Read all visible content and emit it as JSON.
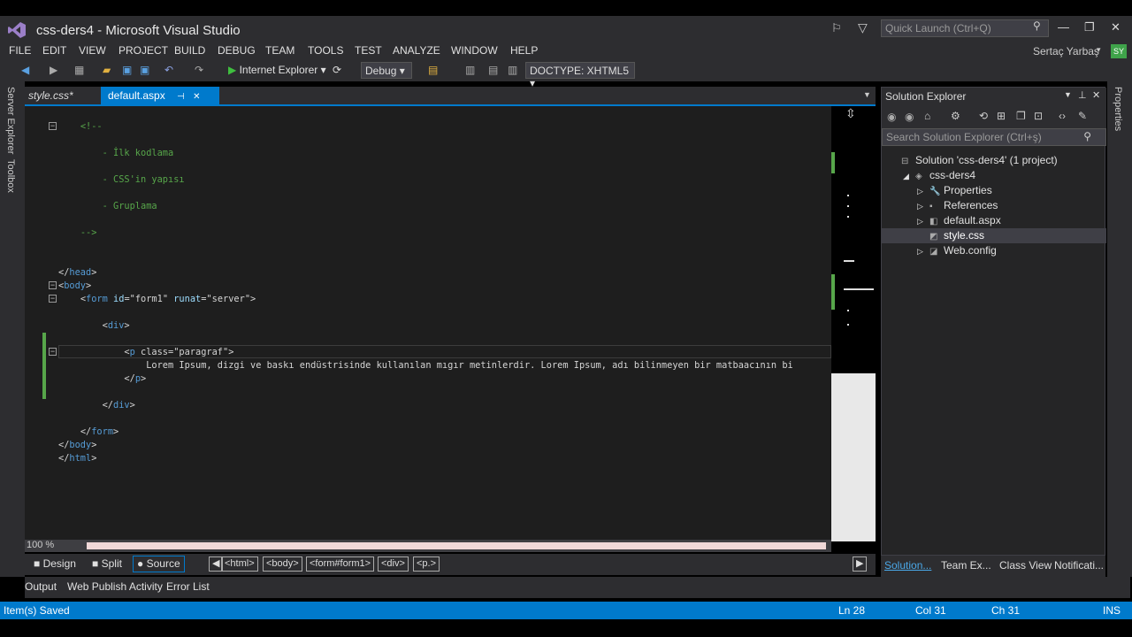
{
  "window": {
    "title": "css-ders4 - Microsoft Visual Studio",
    "quick_launch_placeholder": "Quick Launch (Ctrl+Q)",
    "user_name": "Sertaç Yarbaş",
    "avatar_initials": "SY"
  },
  "menu": [
    "FILE",
    "EDIT",
    "VIEW",
    "PROJECT",
    "BUILD",
    "DEBUG",
    "TEAM",
    "TOOLS",
    "TEST",
    "ANALYZE",
    "WINDOW",
    "HELP"
  ],
  "toolbar": {
    "run_label": "Internet Explorer",
    "config": "Debug",
    "doctype": "DOCTYPE: XHTML5"
  },
  "left_rail": [
    "Server Explorer",
    "Toolbox"
  ],
  "right_rail": [
    "Properties"
  ],
  "tabs": [
    {
      "label": "style.css*",
      "active": false
    },
    {
      "label": "default.aspx",
      "active": true
    }
  ],
  "code": [
    {
      "indent": "    ",
      "parts": [
        {
          "c": "c-comment",
          "t": "<!--"
        }
      ]
    },
    {
      "indent": "        ",
      "parts": [
        {
          "c": "c-comment",
          "t": "- İlk kodlama"
        }
      ]
    },
    {
      "indent": "        ",
      "parts": [
        {
          "c": "c-comment",
          "t": "- CSS'in yapısı"
        }
      ]
    },
    {
      "indent": "        ",
      "parts": [
        {
          "c": "c-comment",
          "t": "- Gruplama"
        }
      ]
    },
    {
      "indent": "    ",
      "parts": [
        {
          "c": "c-comment",
          "t": "-->"
        }
      ]
    },
    {
      "indent": "",
      "parts": [
        {
          "c": "c-plain",
          "t": "</"
        },
        {
          "c": "c-tag",
          "t": "head"
        },
        {
          "c": "c-plain",
          "t": ">"
        }
      ]
    },
    {
      "indent": "",
      "parts": [
        {
          "c": "c-plain",
          "t": "<"
        },
        {
          "c": "c-tag",
          "t": "body"
        },
        {
          "c": "c-plain",
          "t": ">"
        }
      ]
    },
    {
      "indent": "    ",
      "parts": [
        {
          "c": "c-plain",
          "t": "<"
        },
        {
          "c": "c-tag",
          "t": "form"
        },
        {
          "c": "c-plain",
          "t": " "
        },
        {
          "c": "c-attr",
          "t": "id"
        },
        {
          "c": "c-plain",
          "t": "=\"form1\" "
        },
        {
          "c": "c-attr",
          "t": "runat"
        },
        {
          "c": "c-plain",
          "t": "=\"server\">"
        }
      ]
    },
    {
      "indent": "        ",
      "parts": [
        {
          "c": "c-plain",
          "t": "<"
        },
        {
          "c": "c-tag",
          "t": "div"
        },
        {
          "c": "c-plain",
          "t": ">"
        }
      ]
    },
    {
      "indent": "            ",
      "parts": [
        {
          "c": "c-plain",
          "t": "<"
        },
        {
          "c": "c-tag",
          "t": "p"
        },
        {
          "c": "c-plain",
          "t": " class=\"paragraf\">"
        }
      ]
    },
    {
      "indent": "                ",
      "parts": [
        {
          "c": "c-plain",
          "t": "Lorem Ipsum, dizgi ve baskı endüstrisinde kullanılan mıgır metinlerdir. Lorem Ipsum, adı bilinmeyen bir matbaacının bi"
        }
      ]
    },
    {
      "indent": "            ",
      "parts": [
        {
          "c": "c-plain",
          "t": "</"
        },
        {
          "c": "c-tag",
          "t": "p"
        },
        {
          "c": "c-plain",
          "t": ">"
        }
      ]
    },
    {
      "indent": "        ",
      "parts": [
        {
          "c": "c-plain",
          "t": "</"
        },
        {
          "c": "c-tag",
          "t": "div"
        },
        {
          "c": "c-plain",
          "t": ">"
        }
      ]
    },
    {
      "indent": "    ",
      "parts": [
        {
          "c": "c-plain",
          "t": "</"
        },
        {
          "c": "c-tag",
          "t": "form"
        },
        {
          "c": "c-plain",
          "t": ">"
        }
      ]
    },
    {
      "indent": "",
      "parts": [
        {
          "c": "c-plain",
          "t": "</"
        },
        {
          "c": "c-tag",
          "t": "body"
        },
        {
          "c": "c-plain",
          "t": ">"
        }
      ]
    },
    {
      "indent": "",
      "parts": [
        {
          "c": "c-plain",
          "t": "</"
        },
        {
          "c": "c-tag",
          "t": "html"
        },
        {
          "c": "c-plain",
          "t": ">"
        }
      ]
    }
  ],
  "zoom": "100 %",
  "views": {
    "design": "Design",
    "split": "Split",
    "source": "Source"
  },
  "breadcrumbs": [
    "<html>",
    "<body>",
    "<form#form1>",
    "<div>",
    "<p.>"
  ],
  "output_tabs": [
    "Output",
    "Web Publish Activity",
    "Error List"
  ],
  "solution_explorer": {
    "title": "Solution Explorer",
    "search_placeholder": "Search Solution Explorer (Ctrl+ş)",
    "items": [
      {
        "label": "Solution 'css-ders4' (1 project)",
        "level": 0,
        "expander": ""
      },
      {
        "label": "css-ders4",
        "level": 1,
        "expander": "◢"
      },
      {
        "label": "Properties",
        "level": 2,
        "expander": "▷"
      },
      {
        "label": "References",
        "level": 2,
        "expander": "▷"
      },
      {
        "label": "default.aspx",
        "level": 2,
        "expander": "▷"
      },
      {
        "label": "style.css",
        "level": 2,
        "expander": "",
        "selected": true
      },
      {
        "label": "Web.config",
        "level": 2,
        "expander": "▷"
      }
    ],
    "bottom_tabs": [
      "Solution...",
      "Team Ex...",
      "Class View",
      "Notificati..."
    ]
  },
  "status": {
    "message": "Item(s) Saved",
    "line": "Ln 28",
    "col": "Col 31",
    "ch": "Ch 31",
    "mode": "INS"
  },
  "colors": {
    "accent": "#007acc",
    "comment": "#57a64a",
    "tag": "#569cd6",
    "vs_purple": "#68217a"
  }
}
